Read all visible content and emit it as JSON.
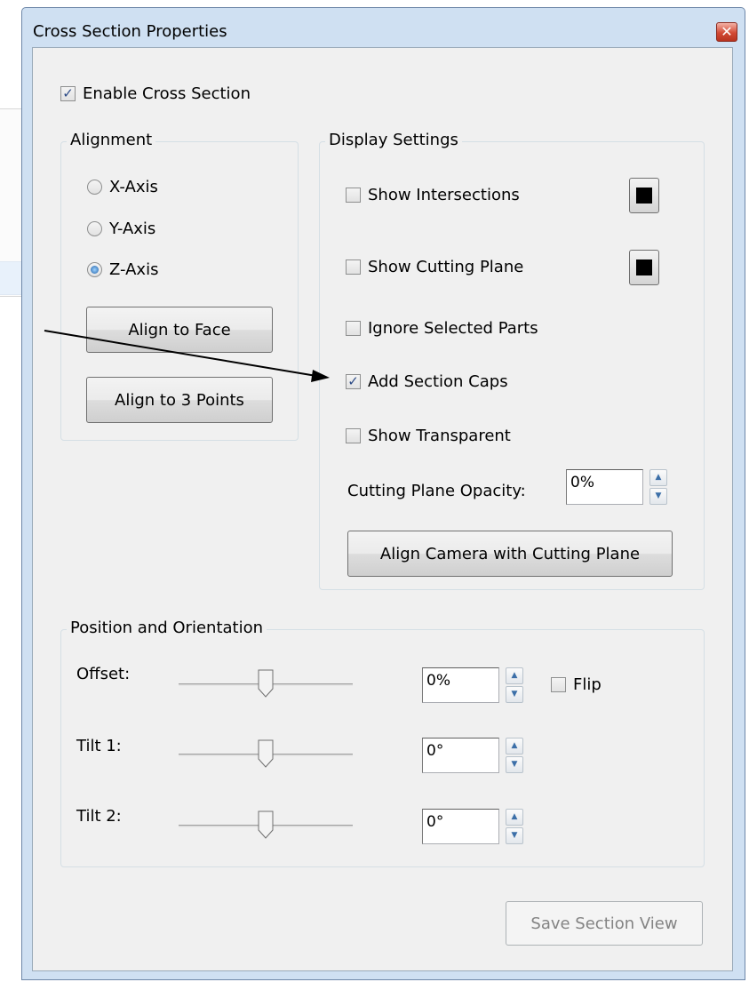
{
  "window": {
    "title": "Cross Section Properties",
    "close_symbol": "✕"
  },
  "enable": {
    "label": "Enable Cross Section",
    "checked": true
  },
  "alignment": {
    "legend": "Alignment",
    "axes": [
      {
        "label": "X-Axis",
        "selected": false
      },
      {
        "label": "Y-Axis",
        "selected": false
      },
      {
        "label": "Z-Axis",
        "selected": true
      }
    ],
    "align_face_label": "Align to Face",
    "align_points_label": "Align to 3 Points"
  },
  "display": {
    "legend": "Display Settings",
    "options": [
      {
        "label": "Show Intersections",
        "checked": false
      },
      {
        "label": "Show Cutting Plane",
        "checked": false
      },
      {
        "label": "Ignore Selected Parts",
        "checked": false
      },
      {
        "label": "Add Section Caps",
        "checked": true
      },
      {
        "label": "Show Transparent",
        "checked": false
      }
    ],
    "intersection_color": "#000000",
    "cutting_plane_color": "#000000",
    "opacity_label": "Cutting Plane Opacity:",
    "opacity_value": "0%",
    "align_camera_label": "Align Camera with Cutting Plane"
  },
  "position": {
    "legend": "Position and Orientation",
    "offset": {
      "label": "Offset:",
      "value": "0%",
      "slider_fraction": 0.5
    },
    "flip": {
      "label": "Flip",
      "checked": false
    },
    "tilt1": {
      "label": "Tilt 1:",
      "value": "0°",
      "slider_fraction": 0.5
    },
    "tilt2": {
      "label": "Tilt 2:",
      "value": "0°",
      "slider_fraction": 0.5
    }
  },
  "save_label": "Save Section View",
  "icons": {
    "check": "✓",
    "spin_up": "▲",
    "spin_down": "▼"
  }
}
